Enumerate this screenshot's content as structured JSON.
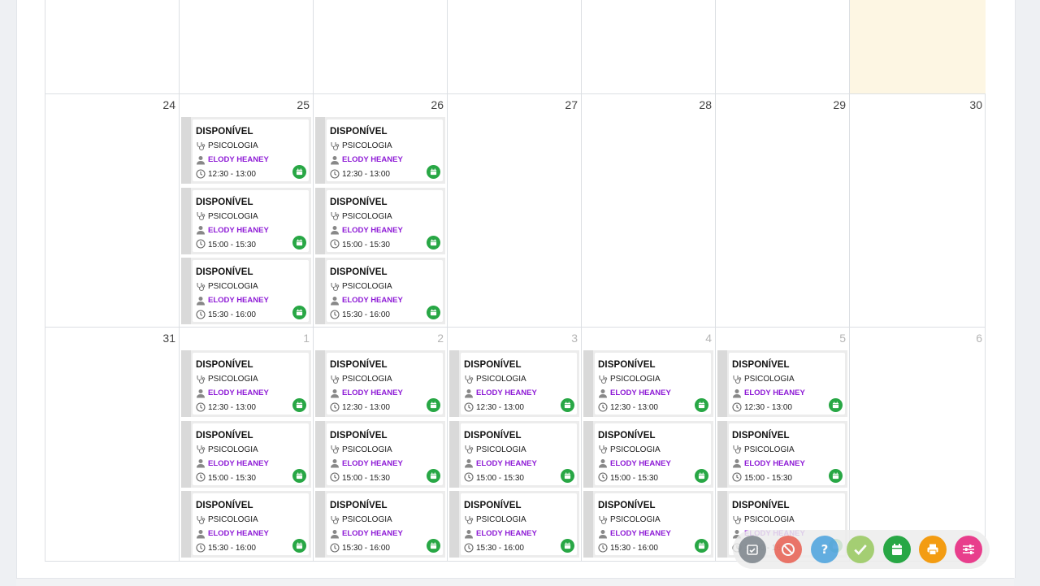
{
  "calendar": {
    "weeks": [
      {
        "days": [
          {
            "num": "",
            "other": false,
            "today": false,
            "slots": false
          },
          {
            "num": "",
            "other": false,
            "today": false,
            "slots": false
          },
          {
            "num": "",
            "other": false,
            "today": false,
            "slots": false
          },
          {
            "num": "",
            "other": false,
            "today": false,
            "slots": false
          },
          {
            "num": "",
            "other": false,
            "today": false,
            "slots": false
          },
          {
            "num": "",
            "other": false,
            "today": false,
            "slots": false
          },
          {
            "num": "",
            "other": false,
            "today": true,
            "slots": false
          }
        ]
      },
      {
        "days": [
          {
            "num": "24",
            "other": false,
            "today": false,
            "slots": false
          },
          {
            "num": "25",
            "other": false,
            "today": false,
            "slots": true
          },
          {
            "num": "26",
            "other": false,
            "today": false,
            "slots": true
          },
          {
            "num": "27",
            "other": false,
            "today": false,
            "slots": false
          },
          {
            "num": "28",
            "other": false,
            "today": false,
            "slots": false
          },
          {
            "num": "29",
            "other": false,
            "today": false,
            "slots": false
          },
          {
            "num": "30",
            "other": false,
            "today": false,
            "slots": false
          }
        ]
      },
      {
        "days": [
          {
            "num": "31",
            "other": false,
            "today": false,
            "slots": false
          },
          {
            "num": "1",
            "other": true,
            "today": false,
            "slots": true
          },
          {
            "num": "2",
            "other": true,
            "today": false,
            "slots": true
          },
          {
            "num": "3",
            "other": true,
            "today": false,
            "slots": true
          },
          {
            "num": "4",
            "other": true,
            "today": false,
            "slots": true
          },
          {
            "num": "5",
            "other": true,
            "today": false,
            "slots": true
          },
          {
            "num": "6",
            "other": true,
            "today": false,
            "slots": false
          }
        ]
      }
    ],
    "slot_template": {
      "status": "DISPONÍVEL",
      "specialty": "PSICOLOGIA",
      "doctor": "ELODY HEANEY"
    },
    "slot_times": [
      "12:30 - 13:00",
      "15:00 - 15:30",
      "15:30 - 16:00"
    ]
  },
  "toolbar": {
    "buttons": [
      {
        "name": "confirm-check-button",
        "icon": "calendar-check-icon",
        "color": "#6c757d"
      },
      {
        "name": "cancel-button",
        "icon": "ban-icon",
        "color": "#e74c3c"
      },
      {
        "name": "unknown-button",
        "icon": "question-icon",
        "color": "#3498db"
      },
      {
        "name": "check-button",
        "icon": "check-icon",
        "color": "#8bc34a"
      },
      {
        "name": "available-button",
        "icon": "calendar-icon",
        "color": "#28a745"
      },
      {
        "name": "print-button",
        "icon": "print-icon",
        "color": "#f39c12"
      },
      {
        "name": "filter-button",
        "icon": "sliders-icon",
        "color": "#e83e8c"
      }
    ]
  },
  "colors": {
    "doctor": "#8e1bd6",
    "available": "#28a745",
    "today_bg": "#fdf6e3"
  }
}
